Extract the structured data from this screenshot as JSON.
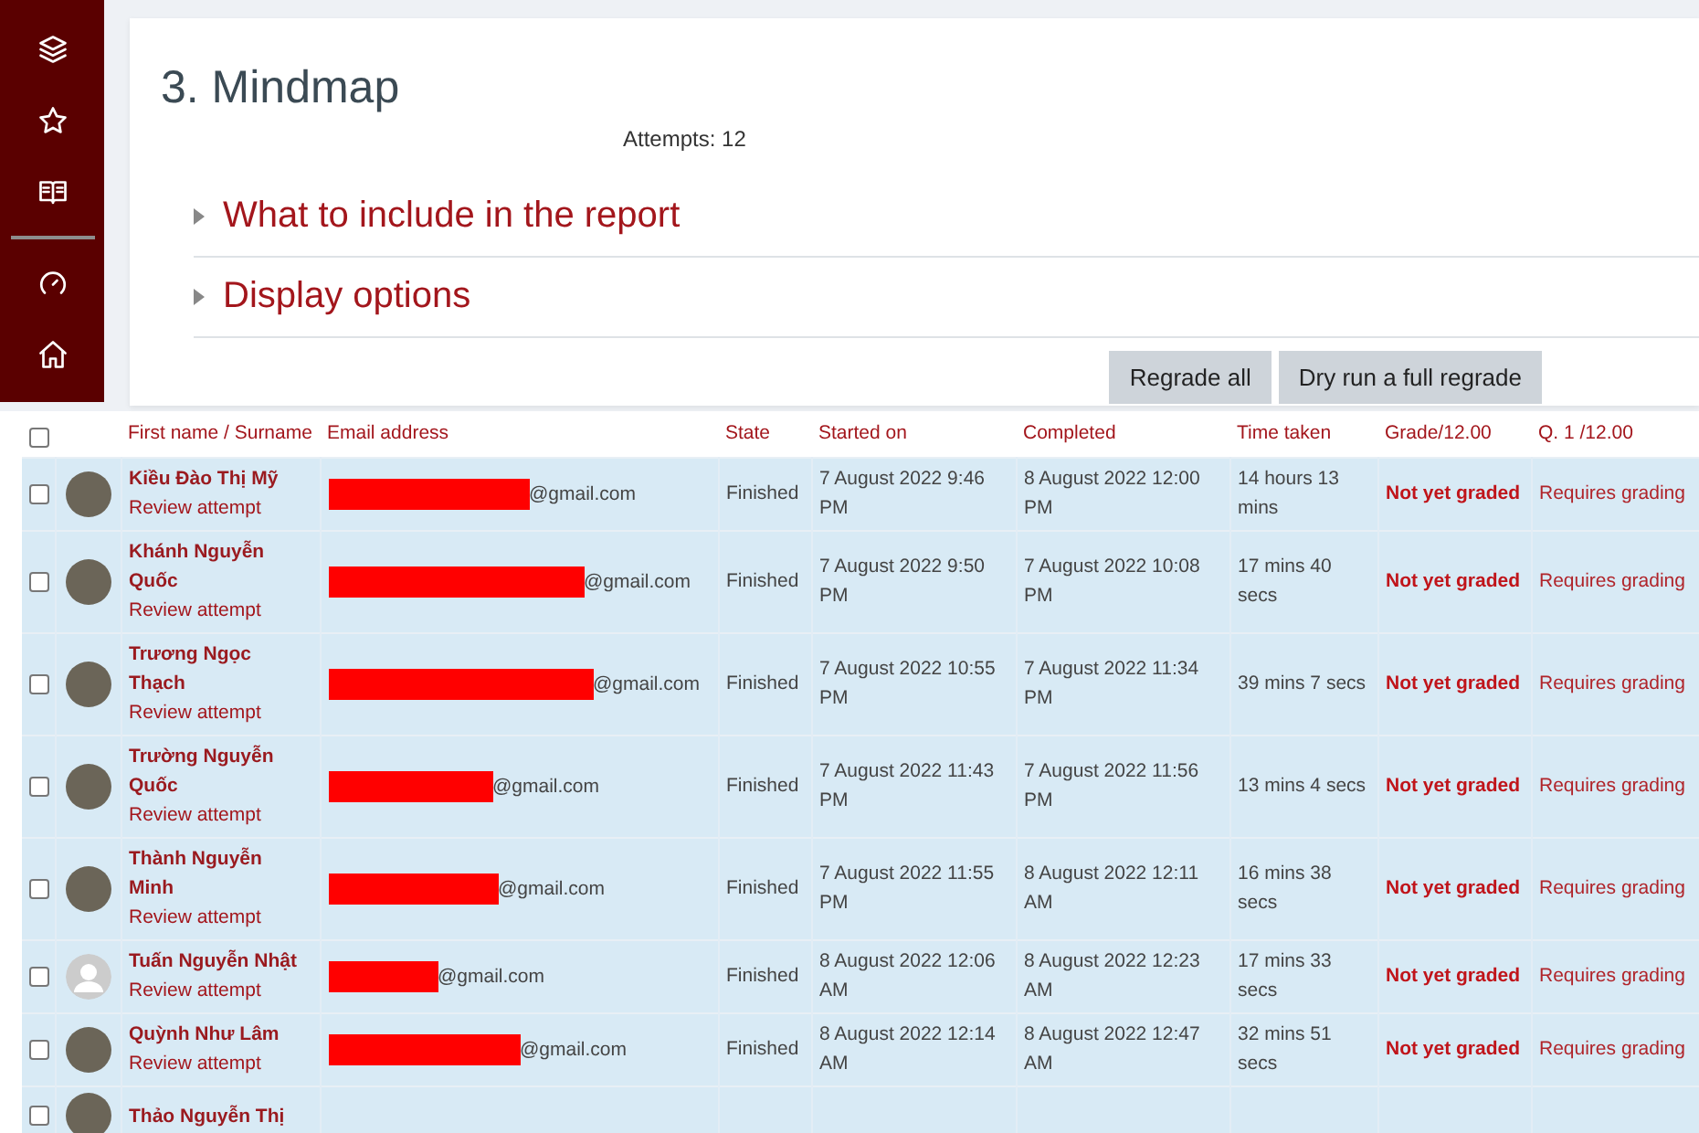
{
  "quiz": {
    "title": "3. Mindmap",
    "attempts": "Attempts: 12",
    "sections": [
      {
        "label": "What to include in the report",
        "expanded": false
      },
      {
        "label": "Display options",
        "expanded": false
      }
    ],
    "buttons": [
      "Regrade all",
      "Dry run a full regrade"
    ]
  },
  "table": {
    "select_all": {
      "checked": false
    },
    "columns": [
      "First name / Surname",
      "Email address",
      "State",
      "Started on",
      "Completed",
      "Time taken",
      "Grade/12.00",
      "Q. 1 /12.00"
    ],
    "rows": [
      {
        "checked": false,
        "has_photo": true,
        "name": "Kiều Đào Thị Mỹ",
        "review": "Review attempt",
        "email": "@gmail.com",
        "state": "Finished",
        "started": "7 August 2022 9:46 PM",
        "completed": "8 August 2022 12:00 PM",
        "time": "14 hours 13 mins",
        "grade": "Not yet graded",
        "q1": "Requires grading"
      },
      {
        "checked": false,
        "has_photo": true,
        "name": "Khánh Nguyễn Quốc",
        "review": "Review attempt",
        "email": "@gmail.com",
        "state": "Finished",
        "started": "7 August 2022 9:50 PM",
        "completed": "7 August 2022 10:08 PM",
        "time": "17 mins 40 secs",
        "grade": "Not yet graded",
        "q1": "Requires grading"
      },
      {
        "checked": false,
        "has_photo": true,
        "name": "Trương Ngọc Thạch",
        "review": "Review attempt",
        "email": "@gmail.com",
        "state": "Finished",
        "started": "7 August 2022 10:55 PM",
        "completed": "7 August 2022 11:34 PM",
        "time": "39 mins 7 secs",
        "grade": "Not yet graded",
        "q1": "Requires grading"
      },
      {
        "checked": false,
        "has_photo": true,
        "name": "Trường Nguyễn Quốc",
        "review": "Review attempt",
        "email": "@gmail.com",
        "state": "Finished",
        "started": "7 August 2022 11:43 PM",
        "completed": "7 August 2022 11:56 PM",
        "time": "13 mins 4 secs",
        "grade": "Not yet graded",
        "q1": "Requires grading"
      },
      {
        "checked": false,
        "has_photo": true,
        "name": "Thành Nguyễn Minh",
        "review": "Review attempt",
        "email": "@gmail.com",
        "state": "Finished",
        "started": "7 August 2022 11:55 PM",
        "completed": "8 August 2022 12:11 AM",
        "time": "16 mins 38 secs",
        "grade": "Not yet graded",
        "q1": "Requires grading"
      },
      {
        "checked": false,
        "has_photo": false,
        "name": "Tuấn Nguyễn Nhật",
        "review": "Review attempt",
        "email": "@gmail.com",
        "state": "Finished",
        "started": "8 August 2022 12:06 AM",
        "completed": "8 August 2022 12:23 AM",
        "time": "17 mins 33 secs",
        "grade": "Not yet graded",
        "q1": "Requires grading"
      },
      {
        "checked": false,
        "has_photo": true,
        "name": "Quỳnh Như Lâm",
        "review": "Review attempt",
        "email": "@gmail.com",
        "state": "Finished",
        "started": "8 August 2022 12:14 AM",
        "completed": "8 August 2022 12:47 AM",
        "time": "32 mins 51 secs",
        "grade": "Not yet graded",
        "q1": "Requires grading"
      },
      {
        "checked": false,
        "has_photo": true,
        "name": "Thảo Nguyễn Thị"
      }
    ]
  }
}
